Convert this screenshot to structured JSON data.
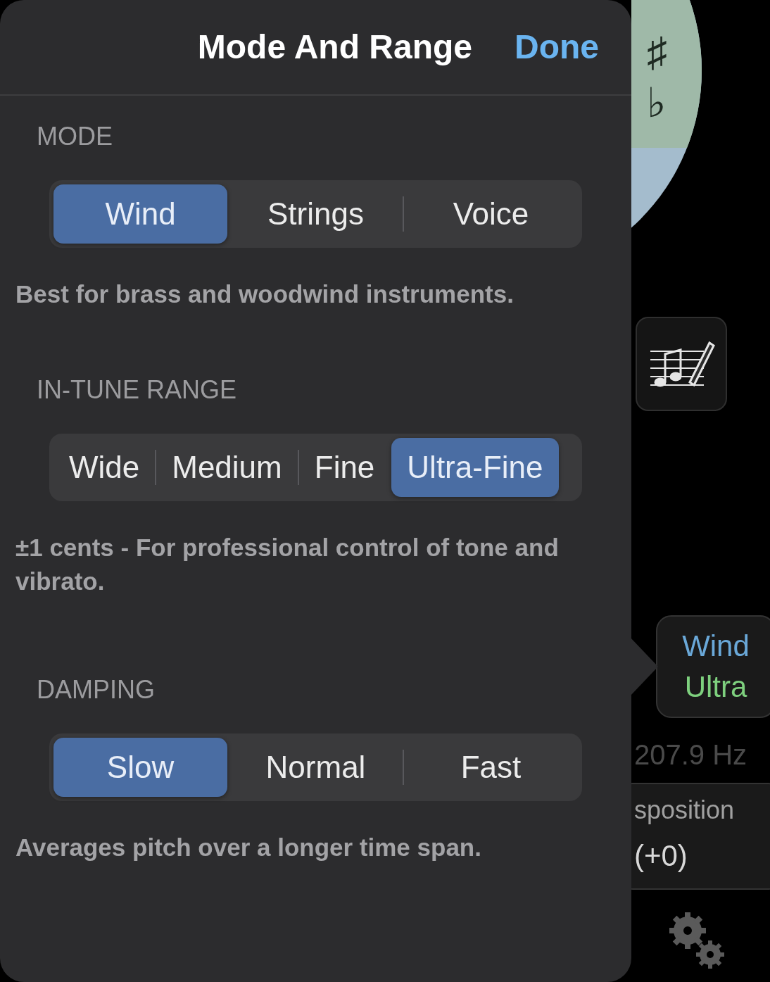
{
  "popover": {
    "title": "Mode And Range",
    "done": "Done"
  },
  "sections": [
    {
      "header": "MODE",
      "options": [
        {
          "label": "Wind",
          "selected": true
        },
        {
          "label": "Strings",
          "selected": false
        },
        {
          "label": "Voice",
          "selected": false
        }
      ],
      "description": "Best for brass and woodwind instruments."
    },
    {
      "header": "IN-TUNE RANGE",
      "options": [
        {
          "label": "Wide",
          "selected": false
        },
        {
          "label": "Medium",
          "selected": false
        },
        {
          "label": "Fine",
          "selected": false
        },
        {
          "label": "Ultra-Fine",
          "selected": true
        }
      ],
      "description": "±1 cents - For professional control of tone and vibrato."
    },
    {
      "header": "DAMPING",
      "options": [
        {
          "label": "Slow",
          "selected": true
        },
        {
          "label": "Normal",
          "selected": false
        },
        {
          "label": "Fast",
          "selected": false
        }
      ],
      "description": "Averages pitch over a longer time span."
    }
  ],
  "background": {
    "dial_symbols": [
      "♯",
      "♭"
    ],
    "mode_badge": {
      "mode": "Wind",
      "range": "Ultra"
    },
    "frequency": "207.9 Hz",
    "transposition": {
      "label": "sposition",
      "value": "(+0)"
    }
  }
}
